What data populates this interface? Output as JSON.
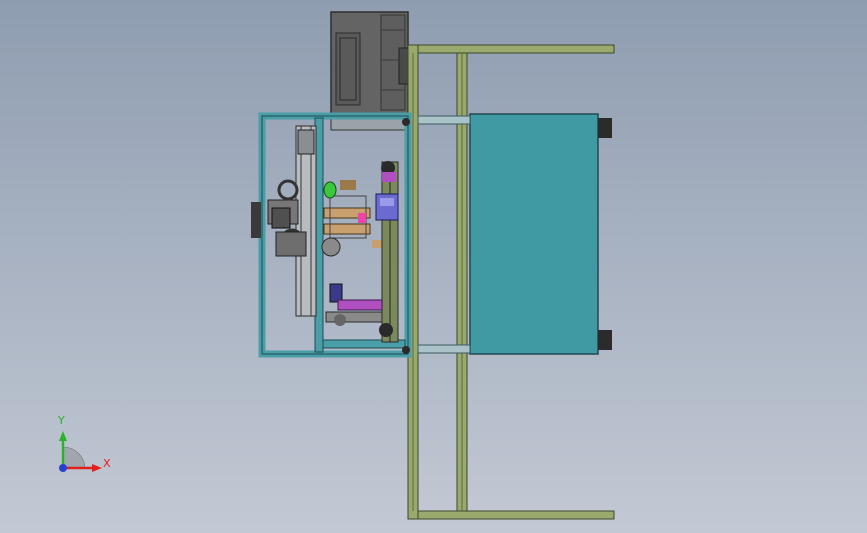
{
  "viewport": {
    "background_top": "#8f9db1",
    "background_bottom": "#c3c9d4"
  },
  "triad": {
    "x_label": "X",
    "y_label": "Y",
    "x_color": "#e0201c",
    "y_color": "#28b428",
    "z_color": "#2840d0"
  },
  "model": {
    "frame_color": "#9aaa6e",
    "tank_color": "#409aa4",
    "machine_color": "#4a9ea8",
    "motor_color": "#646464"
  }
}
